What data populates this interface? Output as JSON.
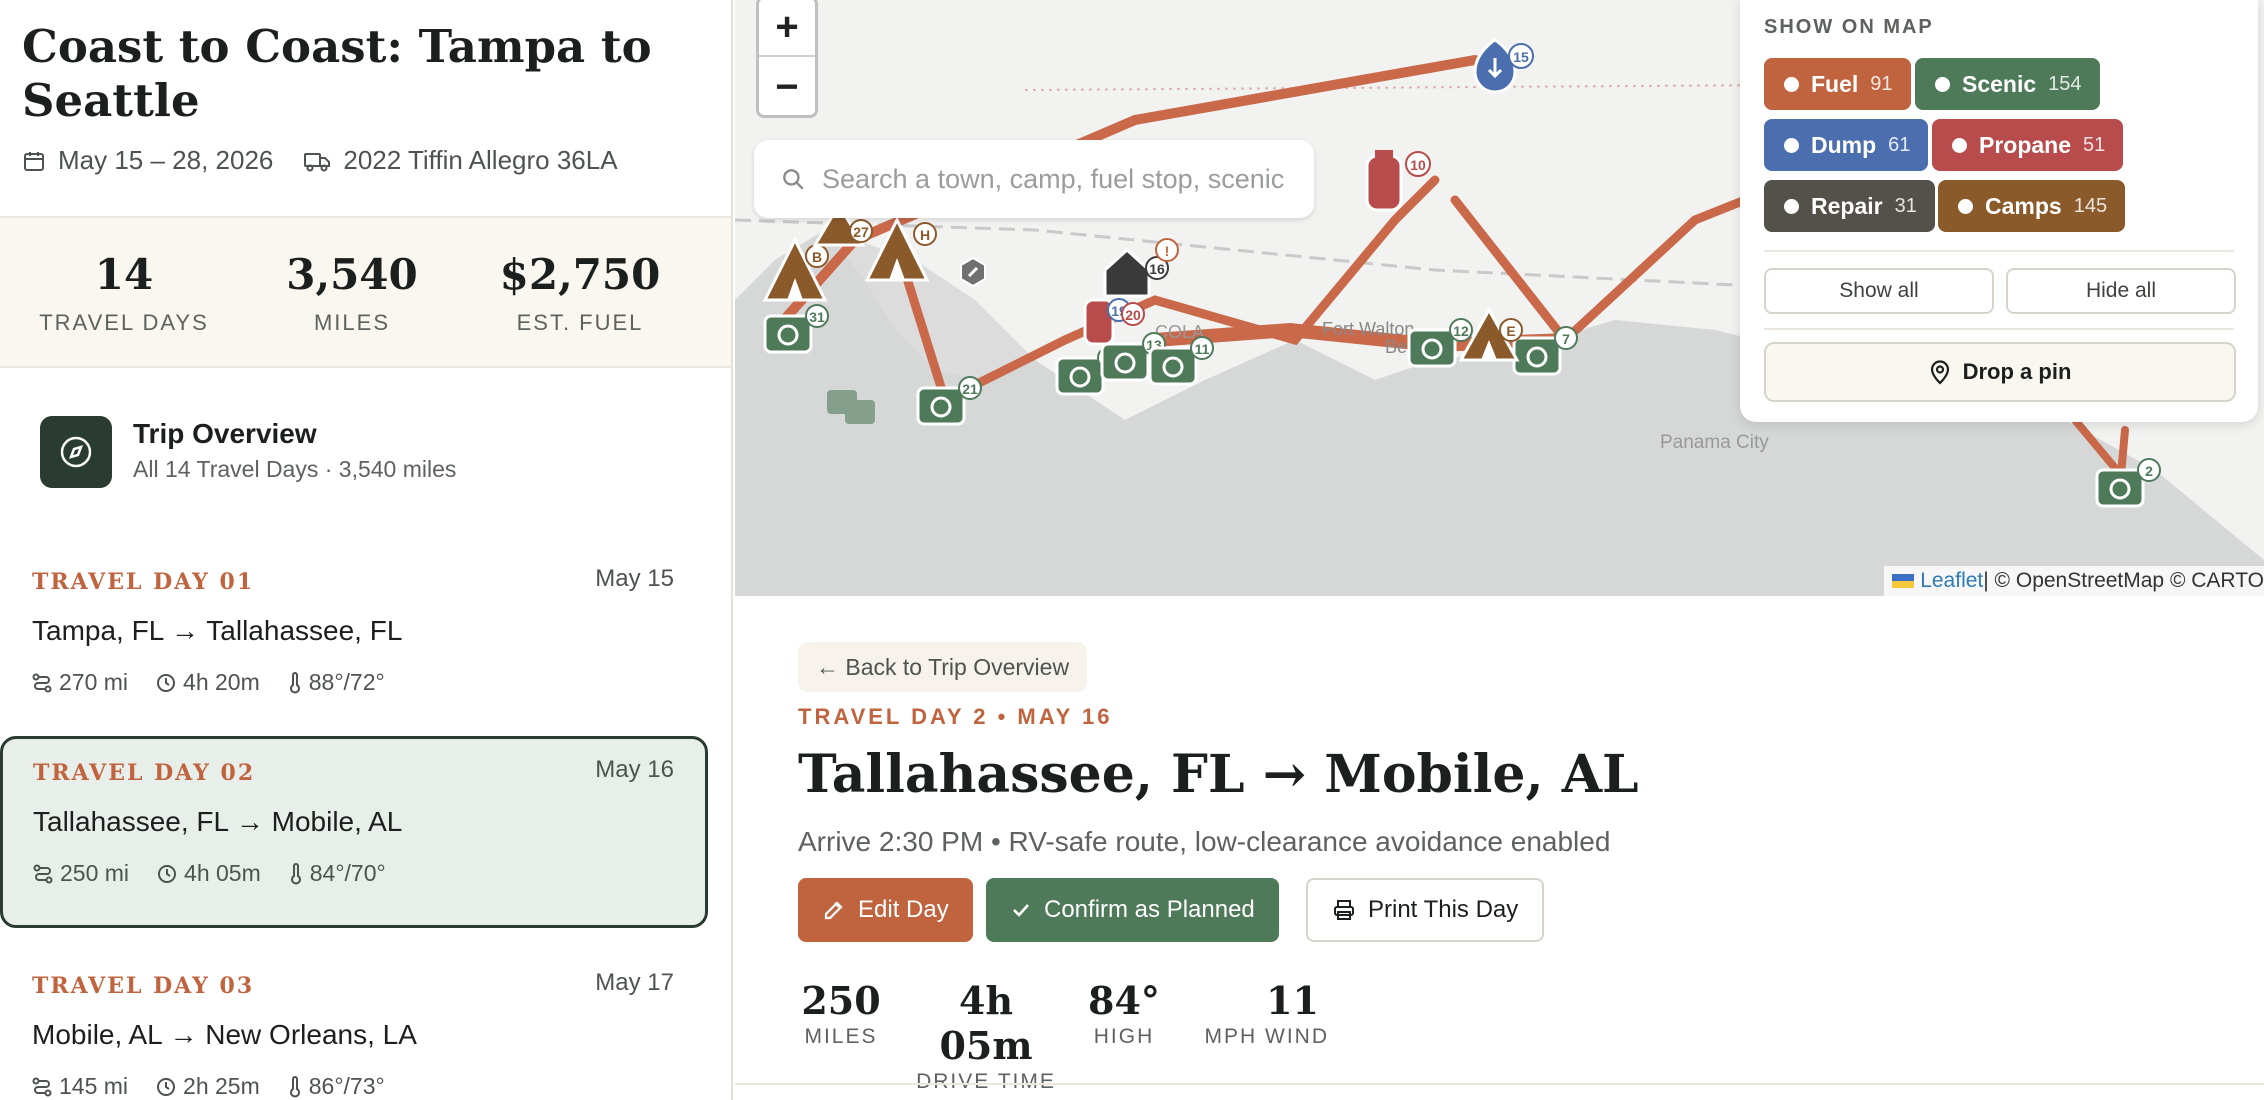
{
  "trip": {
    "title": "Coast to Coast: Tampa to Seattle",
    "dates": "May 15 – 28, 2026",
    "vehicle": "2022 Tiffin Allegro 36LA"
  },
  "stats": [
    {
      "value": "14",
      "label": "TRAVEL DAYS"
    },
    {
      "value": "3,540",
      "label": "MILES"
    },
    {
      "value": "$2,750",
      "label": "EST. FUEL"
    }
  ],
  "overview": {
    "title": "Trip Overview",
    "subtitle": "All 14 Travel Days · 3,540 miles"
  },
  "days": [
    {
      "label": "TRAVEL DAY 01",
      "date": "May 15",
      "route": "Tampa, FL → Tallahassee, FL",
      "miles": "270 mi",
      "time": "4h 20m",
      "temp": "88°/72°"
    },
    {
      "label": "TRAVEL DAY 02",
      "date": "May 16",
      "route": "Tallahassee, FL → Mobile, AL",
      "miles": "250 mi",
      "time": "4h 05m",
      "temp": "84°/70°"
    },
    {
      "label": "TRAVEL DAY 03",
      "date": "May 17",
      "route": "Mobile, AL → New Orleans, LA",
      "miles": "145 mi",
      "time": "2h 25m",
      "temp": "86°/73°"
    }
  ],
  "map": {
    "zoom_in": "+",
    "zoom_out": "−",
    "search_placeholder": "Search a town, camp, fuel stop, scenic",
    "labels": {
      "fort_walton": "Fort Walton",
      "beach": "Beach",
      "panama": "Panama City",
      "pcola": "COLA"
    },
    "attribution": {
      "leaflet": "Leaflet",
      "rest": " | © OpenStreetMap © CARTO"
    },
    "markers": [
      "15",
      "10",
      "2",
      "21",
      "17",
      "13",
      "11",
      "12",
      "7",
      "31",
      "16",
      "19",
      "20",
      "27",
      "E",
      "B",
      "H",
      "!"
    ]
  },
  "filters": {
    "title": "SHOW ON MAP",
    "chips": [
      {
        "name": "Fuel",
        "count": "91",
        "color": "#c0643f"
      },
      {
        "name": "Scenic",
        "count": "154",
        "color": "#4f7a5a"
      },
      {
        "name": "Dump",
        "count": "61",
        "color": "#4b6fae"
      },
      {
        "name": "Propane",
        "count": "51",
        "color": "#b84b4b"
      },
      {
        "name": "Repair",
        "count": "31",
        "color": "#54504a"
      },
      {
        "name": "Camps",
        "count": "145",
        "color": "#8a5a2b"
      }
    ],
    "show_all": "Show all",
    "hide_all": "Hide all",
    "drop_pin": "Drop a pin"
  },
  "detail": {
    "back": "← Back to Trip Overview",
    "kicker": "TRAVEL DAY 2 • MAY 16",
    "title": "Tallahassee, FL → Mobile, AL",
    "subtitle": "Arrive 2:30 PM • RV-safe route, low-clearance avoidance enabled",
    "edit": "Edit Day",
    "confirm": "Confirm as Planned",
    "print": "Print This Day",
    "stats": [
      {
        "value": "250",
        "label": "MILES"
      },
      {
        "value": "4h 05m",
        "label": "DRIVE TIME"
      },
      {
        "value": "84°",
        "label": "HIGH"
      },
      {
        "value": "11",
        "label": "MPH WIND"
      }
    ]
  },
  "colors": {
    "accent": "#c0643f",
    "dark": "#2a3b32",
    "scenic": "#4f7a5a",
    "route": "#c9694a"
  }
}
